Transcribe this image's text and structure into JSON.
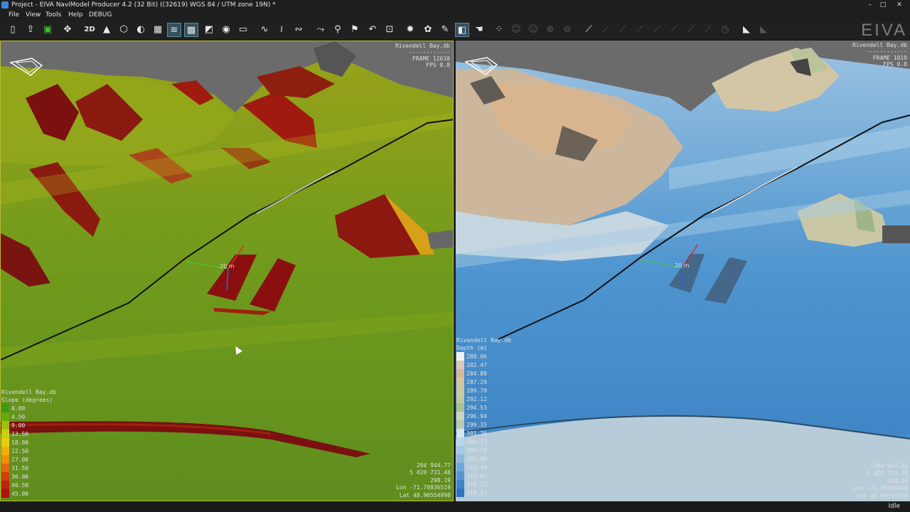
{
  "window": {
    "title": "Project - EIVA NaviModel Producer 4.2  (32 Bit) ((32619) WGS 84 / UTM zone 19N) *",
    "minimize": "–",
    "maximize": "□",
    "close": "✕"
  },
  "menu": [
    "File",
    "View",
    "Tools",
    "Help",
    "DEBUG"
  ],
  "toolbar": {
    "icons": [
      "new-project-icon",
      "open-icon",
      "save-icon",
      "satellite-icon",
      "view-2d-icon",
      "north-arrow-icon",
      "cube-icon",
      "shaded-surface-icon",
      "grid-icon",
      "contour-map-icon",
      "mesh-grid-icon",
      "terrain-icon",
      "camera-icon",
      "ruler-icon",
      "profile-icon",
      "profile-multi-icon",
      "profile-edit-icon",
      "route-icon",
      "pin-icon",
      "pin-edit-icon",
      "undo-path-icon",
      "crop-icon",
      "sun-light-icon",
      "color-palette-icon",
      "paint-brush-icon",
      "fill-icon",
      "hand-pointer-icon",
      "point-cloud-icon",
      "point-filter-icon",
      "point-select-icon",
      "point-add-icon",
      "point-remove-icon",
      "line-tool-icon",
      "line-tool-2-icon",
      "line-tool-3-icon",
      "line-tool-4-icon",
      "line-tool-5-icon",
      "line-tool-6-icon",
      "line-tool-7-icon",
      "clock-icon",
      "slope-profile-icon",
      "slope-profile-2-icon"
    ],
    "view_2d_label": "2D",
    "logo_text": "EIVA"
  },
  "left_view": {
    "db_name": "Rivendell Bay.db",
    "dashes": "------------",
    "frame": "FRAME 12610",
    "fps": "FPS 8.8",
    "scale_label": "20 m",
    "legend_db": "Rivendell Bay.db",
    "legend_title": "Slope (degrees)",
    "legend": [
      {
        "value": "0.00",
        "color": "#3f9a12"
      },
      {
        "value": "4.50",
        "color": "#6aa80f"
      },
      {
        "value": "9.00",
        "color": "#9fbf0d"
      },
      {
        "value": "13.50",
        "color": "#cdd10c"
      },
      {
        "value": "18.00",
        "color": "#e8cf0c"
      },
      {
        "value": "22.50",
        "color": "#f0b10c"
      },
      {
        "value": "27.00",
        "color": "#ee8f0c"
      },
      {
        "value": "31.50",
        "color": "#e2670c"
      },
      {
        "value": "36.00",
        "color": "#cf3f0c"
      },
      {
        "value": "40.50",
        "color": "#c0200c"
      },
      {
        "value": "45.00",
        "color": "#b0100c"
      }
    ],
    "coords": [
      "294 944.77",
      "5 420 731.48",
      "298.19",
      "Lon -71.79836519",
      "Lat 48.90554998"
    ]
  },
  "right_view": {
    "db_name": "Rivendell Bay.db",
    "dashes": "------------",
    "frame": "FRAME 1019",
    "fps": "FPS 0.8",
    "scale_label": "20 m",
    "legend_db": "Rivendell Bay.db",
    "legend_title": "Depth (m)",
    "legend": [
      {
        "value": "280.06",
        "color": "#f2f2f2"
      },
      {
        "value": "282.47",
        "color": "#dcc9b8"
      },
      {
        "value": "284.88",
        "color": "#d9b696"
      },
      {
        "value": "287.29",
        "color": "#d7c49f"
      },
      {
        "value": "289.70",
        "color": "#cfc7a3"
      },
      {
        "value": "292.12",
        "color": "#bfcc9c"
      },
      {
        "value": "294.53",
        "color": "#a9c28f"
      },
      {
        "value": "296.94",
        "color": "#c9d8b8"
      },
      {
        "value": "299.35",
        "color": "#b7cbb0"
      },
      {
        "value": "301.76",
        "color": "#d7e6ef"
      },
      {
        "value": "304.17",
        "color": "#bcd6e8"
      },
      {
        "value": "306.58",
        "color": "#a6c9e4"
      },
      {
        "value": "308.99",
        "color": "#8cbadf"
      },
      {
        "value": "311.40",
        "color": "#6fa8d8"
      },
      {
        "value": "313.81",
        "color": "#5596d0"
      },
      {
        "value": "316.22",
        "color": "#3f86c8"
      },
      {
        "value": "318.63",
        "color": "#2c74bd"
      }
    ],
    "coords": [
      "294 942.65",
      "5 420 731.74",
      "298.19",
      "Lon -71.79839430",
      "Lat 48.90555126"
    ]
  },
  "status": {
    "text": "Idle"
  }
}
